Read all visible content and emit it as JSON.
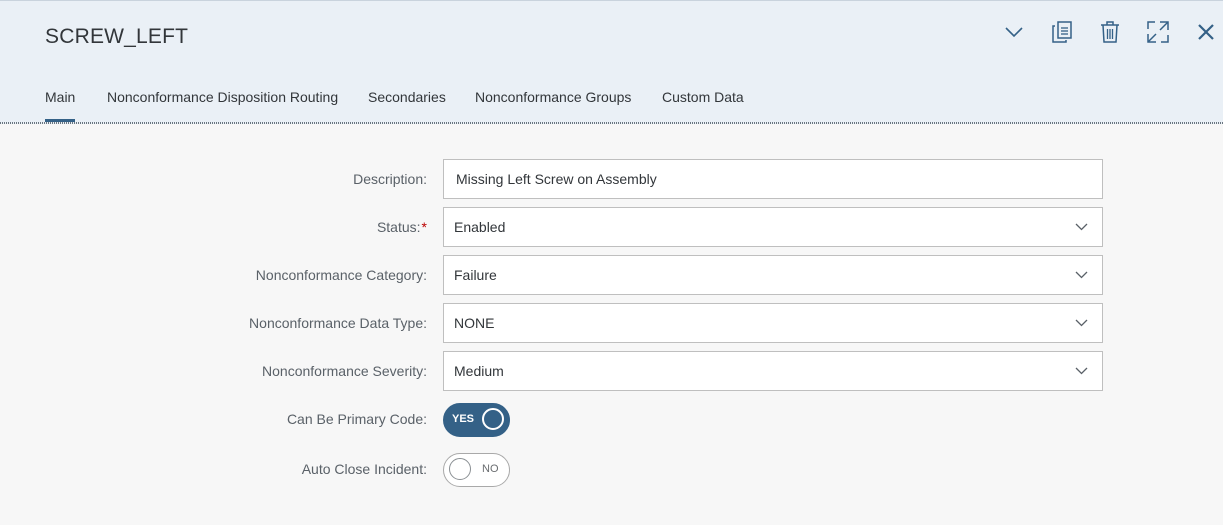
{
  "header": {
    "title": "SCREW_LEFT",
    "actions": [
      "chevron-down-icon",
      "copy-icon",
      "delete-icon",
      "fullscreen-icon",
      "close-icon"
    ],
    "accent_color": "#346187"
  },
  "tabs": [
    {
      "label": "Main",
      "active": true
    },
    {
      "label": "Nonconformance Disposition Routing",
      "active": false
    },
    {
      "label": "Secondaries",
      "active": false
    },
    {
      "label": "Nonconformance Groups",
      "active": false
    },
    {
      "label": "Custom Data",
      "active": false
    }
  ],
  "form": {
    "description": {
      "label": "Description:",
      "value": "Missing Left Screw on Assembly"
    },
    "status": {
      "label": "Status:",
      "required_mark": "*",
      "value": "Enabled"
    },
    "category": {
      "label": "Nonconformance Category:",
      "value": "Failure"
    },
    "data_type": {
      "label": "Nonconformance Data Type:",
      "value": "NONE"
    },
    "severity": {
      "label": "Nonconformance Severity:",
      "value": "Medium"
    },
    "primary_code": {
      "label": "Can Be Primary Code:",
      "state": "YES"
    },
    "auto_close": {
      "label": "Auto Close Incident:",
      "state": "NO"
    }
  }
}
